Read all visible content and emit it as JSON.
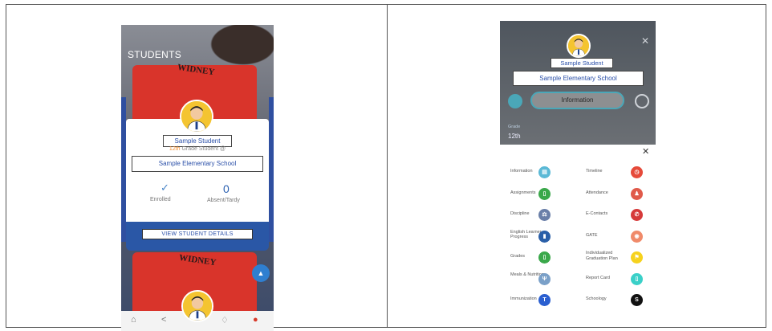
{
  "left_phone": {
    "section_title": "STUDENTS",
    "shirt_text": "WIDNEY",
    "student_name": "Sample Student",
    "grade_value": "12th",
    "grade_suffix": " Grade Student @",
    "school_name": "Sample Elementary School",
    "enrolled_label": "Enrolled",
    "absent_count": "0",
    "absent_label": "Absent/Tardy",
    "details_button": "VIEW STUDENT DETAILS",
    "shirt2_text": "WIDNEY"
  },
  "right_phone": {
    "student_name": "Sample Student",
    "school_name": "Sample Elementary School",
    "info_pill": "Information",
    "grade_label": "Grade",
    "grade_value": "12th",
    "menu_left": [
      {
        "label": "Information",
        "icon": "id-card-icon",
        "color": "#5bb9d6",
        "glyph": "▤"
      },
      {
        "label": "Assignments",
        "icon": "clipboard-icon",
        "color": "#3aa84a",
        "glyph": "▯"
      },
      {
        "label": "Discipline",
        "icon": "gavel-icon",
        "color": "#6a7fa8",
        "glyph": "⚖"
      },
      {
        "label": "English Learner Progress",
        "icon": "book-icon",
        "color": "#2a5fa8",
        "glyph": "▮"
      },
      {
        "label": "Grades",
        "icon": "report-icon",
        "color": "#3aa84a",
        "glyph": "▯"
      },
      {
        "label": "Meals & Nutrition",
        "icon": "utensils-icon",
        "color": "#7aa0c8",
        "glyph": "Ψ"
      },
      {
        "label": "Immunization",
        "icon": "syringe-icon",
        "color": "#2a5fd0",
        "glyph": "T"
      }
    ],
    "menu_right": [
      {
        "label": "Timeline",
        "icon": "timeline-icon",
        "color": "#e64a3a",
        "glyph": "◷"
      },
      {
        "label": "Attendance",
        "icon": "attendance-icon",
        "color": "#e05a4a",
        "glyph": "♟"
      },
      {
        "label": "E-Contacts",
        "icon": "phone-icon",
        "color": "#d63a3a",
        "glyph": "✆"
      },
      {
        "label": "GATE",
        "icon": "gate-icon",
        "color": "#f08a6a",
        "glyph": "◉"
      },
      {
        "label": "Individualized Graduation Plan",
        "icon": "flag-icon",
        "color": "#f6d21e",
        "glyph": "⚑"
      },
      {
        "label": "Report Card",
        "icon": "report-card-icon",
        "color": "#3ad0c8",
        "glyph": "▯"
      },
      {
        "label": "Schoology",
        "icon": "schoology-icon",
        "color": "#111111",
        "glyph": "S"
      }
    ]
  }
}
